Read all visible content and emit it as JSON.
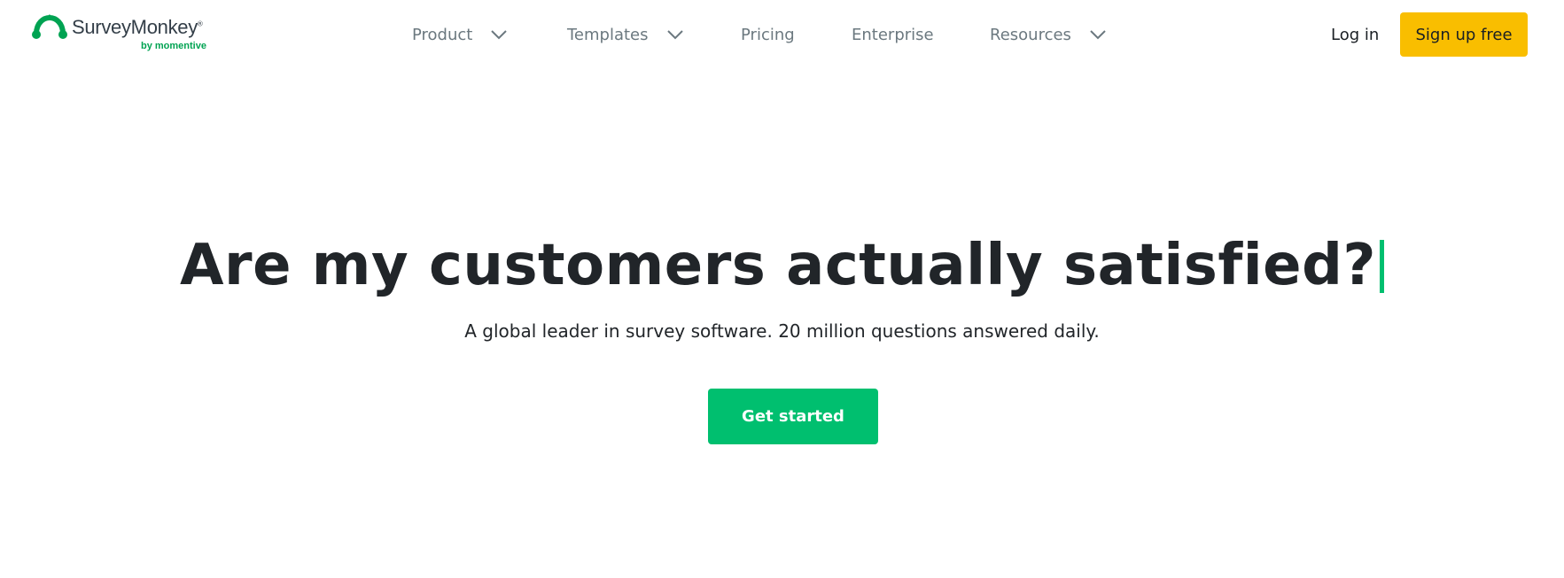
{
  "header": {
    "logo": {
      "wordmark": "SurveyMonkey",
      "trademark": "®",
      "tagline": "by momentive"
    },
    "nav": [
      {
        "label": "Product",
        "has_dropdown": true
      },
      {
        "label": "Templates",
        "has_dropdown": true
      },
      {
        "label": "Pricing",
        "has_dropdown": false
      },
      {
        "label": "Enterprise",
        "has_dropdown": false
      },
      {
        "label": "Resources",
        "has_dropdown": true
      }
    ],
    "login_label": "Log in",
    "signup_label": "Sign up free"
  },
  "hero": {
    "title": "Are my customers actually satisfied?",
    "subtitle": "A global leader in survey software. 20 million questions answered daily.",
    "cta_label": "Get started"
  },
  "colors": {
    "brand_green": "#00bf6f",
    "logo_green": "#00a352",
    "signup_yellow": "#f9be00",
    "nav_text": "#6b787f",
    "heading_text": "#212529"
  }
}
